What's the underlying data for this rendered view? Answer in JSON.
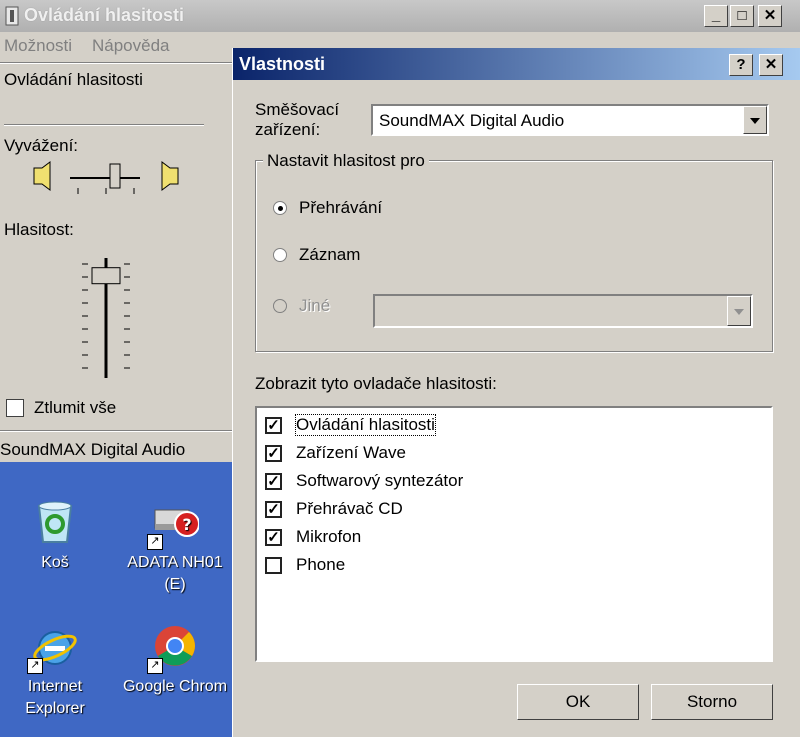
{
  "back_window": {
    "title": "Ovládání hlasitosti",
    "menu": [
      "Možnosti",
      "Nápověda"
    ],
    "panel_title": "Ovládání hlasitosti",
    "balance_label": "Vyvážení:",
    "volume_label": "Hlasitost:",
    "volume_level": 0.93,
    "mute_label": "Ztlumit vše",
    "mute_checked": false,
    "device_name": "SoundMAX Digital Audio",
    "buttons": {
      "minimize": "_",
      "maximize": "□",
      "close": "✕"
    }
  },
  "dialog": {
    "title": "Vlastnosti",
    "help_button": "?",
    "close_button": "✕",
    "mixer_label_line1": "Směšovací",
    "mixer_label_line2": "zařízení:",
    "mixer_value": "SoundMAX Digital Audio",
    "group_label": "Nastavit hlasitost pro",
    "radios": [
      {
        "label": "Přehrávání",
        "selected": true,
        "enabled": true
      },
      {
        "label": "Záznam",
        "selected": false,
        "enabled": true
      },
      {
        "label": "Jiné",
        "selected": false,
        "enabled": false
      }
    ],
    "list_label": "Zobrazit tyto ovladače hlasitosti:",
    "controls": [
      {
        "label": "Ovládání hlasitosti",
        "checked": true
      },
      {
        "label": "Zařízení Wave",
        "checked": true
      },
      {
        "label": "Softwarový syntezátor",
        "checked": true
      },
      {
        "label": "Přehrávač CD",
        "checked": true
      },
      {
        "label": "Mikrofon",
        "checked": true
      },
      {
        "label": "Phone",
        "checked": false
      }
    ],
    "ok_label": "OK",
    "cancel_label": "Storno"
  },
  "desktop": {
    "icons": [
      {
        "label": "Koš",
        "icon": "recycle-bin-icon"
      },
      {
        "label_line1": "ADATA NH01",
        "label_line2": "(E)",
        "icon": "unknown-drive-icon"
      },
      {
        "label_line1": "Internet",
        "label_line2": "Explorer",
        "icon": "internet-explorer-icon"
      },
      {
        "label": "Google Chrom",
        "icon": "chrome-icon"
      }
    ]
  },
  "colors": {
    "dialog_title_start": "#0a246a",
    "dialog_title_end": "#a6caf0",
    "window_face": "#d4d0c8",
    "desktop": "#3f68c4"
  }
}
